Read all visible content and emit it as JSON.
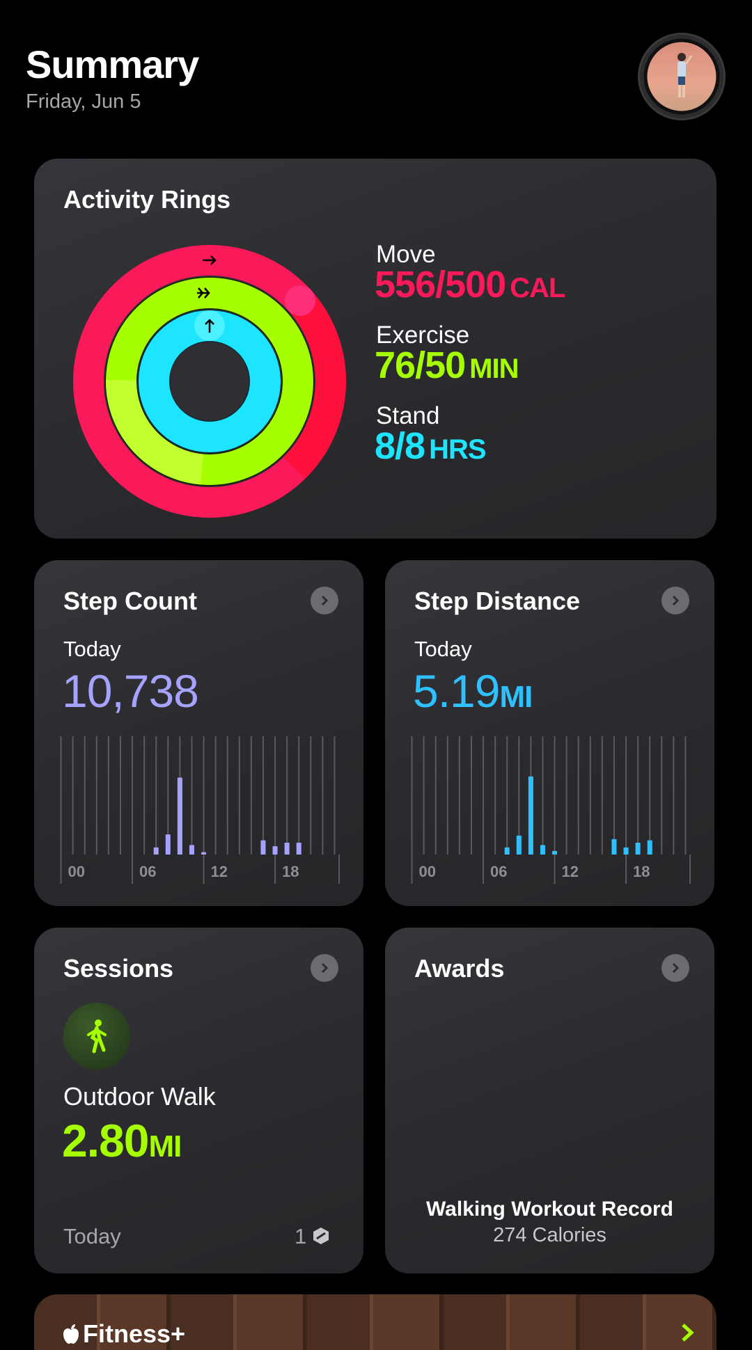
{
  "header": {
    "title": "Summary",
    "date": "Friday, Jun 5"
  },
  "activity": {
    "title": "Activity Rings",
    "move": {
      "label": "Move",
      "value": "556/500",
      "unit": "CAL",
      "color": "#fa1a5a"
    },
    "exercise": {
      "label": "Exercise",
      "value": "76/50",
      "unit": "MIN",
      "color": "#a6ff00"
    },
    "stand": {
      "label": "Stand",
      "value": "8/8",
      "unit": "HRS",
      "color": "#1ee5ff"
    }
  },
  "step_count": {
    "title": "Step Count",
    "period": "Today",
    "value": "10,738",
    "color": "#a6a3ff",
    "axis": [
      "00",
      "06",
      "12",
      "18"
    ]
  },
  "step_distance": {
    "title": "Step Distance",
    "period": "Today",
    "value": "5.19",
    "unit": "MI",
    "color": "#2fc1ff",
    "axis": [
      "00",
      "06",
      "12",
      "18"
    ]
  },
  "sessions": {
    "title": "Sessions",
    "workout": "Outdoor Walk",
    "value": "2.80",
    "unit": "MI",
    "footer_left": "Today",
    "count": "1",
    "color": "#a6ff00"
  },
  "awards": {
    "title": "Awards",
    "award_name": "Walking Workout Record",
    "award_detail": "274 Calories"
  },
  "fitness_plus": {
    "label": "Fitness+"
  },
  "chart_data": [
    {
      "type": "bar",
      "title": "Step Count",
      "x_ticks": [
        "00",
        "06",
        "12",
        "18"
      ],
      "hours": [
        0,
        1,
        2,
        3,
        4,
        5,
        6,
        7,
        8,
        9,
        10,
        11,
        12,
        13,
        14,
        15,
        16,
        17,
        18,
        19,
        20,
        21,
        22,
        23
      ],
      "values": [
        0,
        0,
        0,
        0,
        0,
        0,
        0,
        0,
        0.06,
        0.17,
        0.65,
        0.08,
        0.02,
        0,
        0,
        0,
        0,
        0.12,
        0.07,
        0.1,
        0.1,
        0,
        0,
        0
      ],
      "ylim": [
        0,
        1
      ]
    },
    {
      "type": "bar",
      "title": "Step Distance",
      "x_ticks": [
        "00",
        "06",
        "12",
        "18"
      ],
      "hours": [
        0,
        1,
        2,
        3,
        4,
        5,
        6,
        7,
        8,
        9,
        10,
        11,
        12,
        13,
        14,
        15,
        16,
        17,
        18,
        19,
        20,
        21,
        22,
        23
      ],
      "values": [
        0,
        0,
        0,
        0,
        0,
        0,
        0,
        0,
        0.06,
        0.16,
        0.66,
        0.08,
        0.03,
        0,
        0,
        0,
        0,
        0.13,
        0.06,
        0.1,
        0.12,
        0,
        0,
        0
      ],
      "ylim": [
        0,
        1
      ]
    }
  ]
}
